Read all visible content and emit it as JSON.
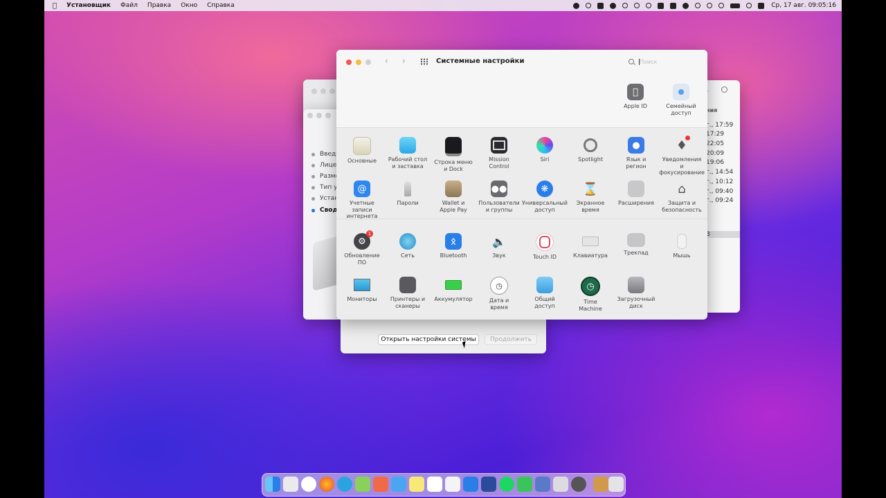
{
  "menubar": {
    "app_name": "Установщик",
    "items": [
      "Файл",
      "Правка",
      "Окно",
      "Справка"
    ],
    "clock": "Ср, 17 авг.  09:05:16"
  },
  "background_window": {
    "sidebar_items": [
      "Введен",
      "Лиценз",
      "Размещ",
      "Тип уст",
      "Установ",
      "Сводка"
    ]
  },
  "finder_window": {
    "header": "ния",
    "rows": [
      "г., 17:59",
      "17:29",
      "22:05",
      "20:09",
      "19:06",
      "г., 14:54",
      "г., 10:12",
      "г., 09:40",
      "г., 09:24",
      "3"
    ]
  },
  "installer": {
    "open_settings_label": "Открыть настройки системы",
    "continue_label": "Продолжить"
  },
  "prefs": {
    "title": "Системные настройки",
    "search_placeholder": "Поиск",
    "top_panes": [
      {
        "label": "Apple ID",
        "icon": "apple-id-icon"
      },
      {
        "label": "Семейный\nдоступ",
        "icon": "family-sharing-icon"
      }
    ],
    "row1": [
      {
        "label": "Основные",
        "icon": "general-icon"
      },
      {
        "label": "Рабочий стол\nи заставка",
        "icon": "desktop-screensaver-icon"
      },
      {
        "label": "Строка меню\nи Dock",
        "icon": "menubar-dock-icon"
      },
      {
        "label": "Mission\nControl",
        "icon": "mission-control-icon"
      },
      {
        "label": "Siri",
        "icon": "siri-icon"
      },
      {
        "label": "Spotlight",
        "icon": "spotlight-icon"
      },
      {
        "label": "Язык и\nрегион",
        "icon": "language-region-icon"
      },
      {
        "label": "Уведомления\nи фокусирование",
        "icon": "notifications-icon"
      }
    ],
    "row2": [
      {
        "label": "Учетные\nзаписи интернета",
        "icon": "internet-accounts-icon"
      },
      {
        "label": "Пароли",
        "icon": "passwords-icon"
      },
      {
        "label": "Wallet и\nApple Pay",
        "icon": "wallet-icon"
      },
      {
        "label": "Пользователи\nи группы",
        "icon": "users-groups-icon"
      },
      {
        "label": "Универсальный\nдоступ",
        "icon": "accessibility-icon"
      },
      {
        "label": "Экранное\nвремя",
        "icon": "screen-time-icon"
      },
      {
        "label": "Расширения",
        "icon": "extensions-icon"
      },
      {
        "label": "Защита и\nбезопасность",
        "icon": "security-icon"
      }
    ],
    "row3": [
      {
        "label": "Обновление\nПО",
        "icon": "software-update-icon",
        "badge": "1"
      },
      {
        "label": "Сеть",
        "icon": "network-icon"
      },
      {
        "label": "Bluetooth",
        "icon": "bluetooth-icon"
      },
      {
        "label": "Звук",
        "icon": "sound-icon"
      },
      {
        "label": "Touch ID",
        "icon": "touch-id-icon"
      },
      {
        "label": "Клавиатура",
        "icon": "keyboard-icon"
      },
      {
        "label": "Трекпад",
        "icon": "trackpad-icon"
      },
      {
        "label": "Мышь",
        "icon": "mouse-icon"
      }
    ],
    "row4": [
      {
        "label": "Мониторы",
        "icon": "displays-icon"
      },
      {
        "label": "Принтеры и\nсканеры",
        "icon": "printers-icon"
      },
      {
        "label": "Аккумулятор",
        "icon": "battery-icon"
      },
      {
        "label": "Дата и\nвремя",
        "icon": "date-time-icon"
      },
      {
        "label": "Общий\nдоступ",
        "icon": "sharing-icon"
      },
      {
        "label": "Time\nMachine",
        "icon": "time-machine-icon"
      },
      {
        "label": "Загрузочный\nдиск",
        "icon": "startup-disk-icon"
      }
    ]
  }
}
